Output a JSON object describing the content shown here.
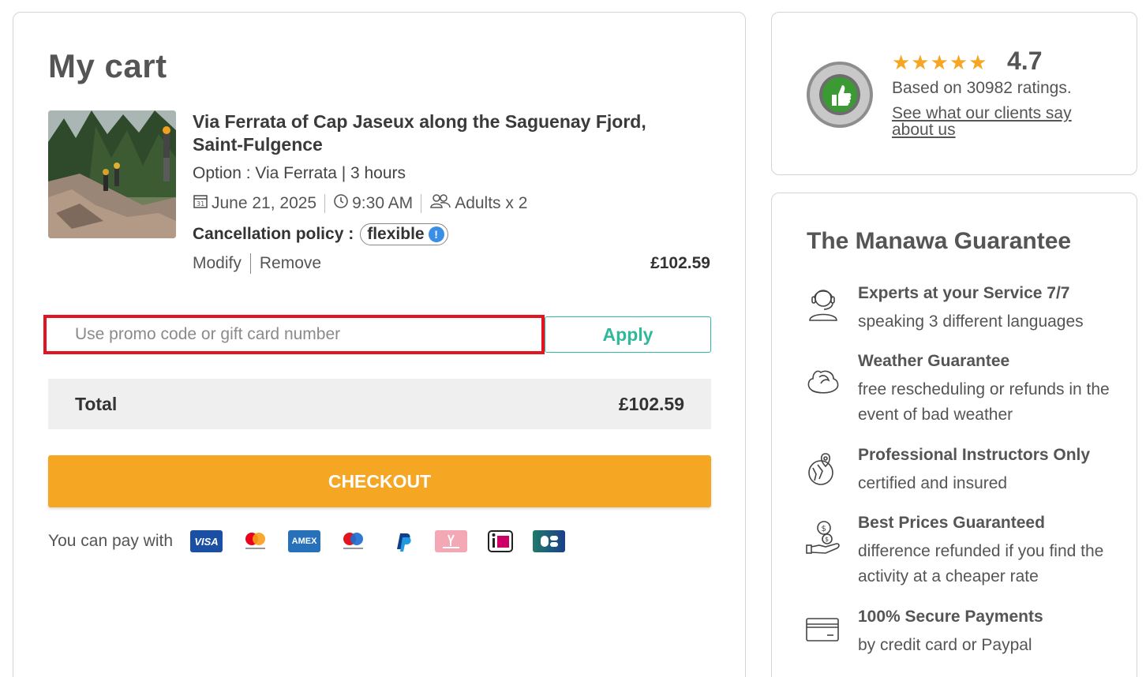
{
  "cart": {
    "title": "My cart",
    "item": {
      "title": "Via Ferrata of Cap Jaseux along the Saguenay Fjord, Saint-Fulgence",
      "option": "Option : Via Ferrata | 3 hours",
      "date": "June 21, 2025",
      "time": "9:30 AM",
      "participants": "Adults x 2",
      "cancellation_label": "Cancellation policy :",
      "cancellation_value": "flexible",
      "modify_label": "Modify",
      "remove_label": "Remove",
      "price": "£102.59"
    },
    "promo": {
      "placeholder": "Use promo code or gift card number",
      "apply_label": "Apply"
    },
    "total": {
      "label": "Total",
      "value": "£102.59"
    },
    "checkout_label": "CHECKOUT",
    "payment": {
      "label": "You can pay with",
      "methods": [
        "visa",
        "mastercard",
        "amex",
        "maestro",
        "paypal",
        "sofort",
        "ideal",
        "cb"
      ]
    }
  },
  "rating": {
    "stars": "★★★★★",
    "value": "4.7",
    "count": "Based on 30982 ratings.",
    "link": "See what our clients say about us"
  },
  "guarantee": {
    "title": "The Manawa Guarantee",
    "items": [
      {
        "icon": "headset-icon",
        "head": "Experts at your Service 7/7",
        "desc": "speaking 3 different languages"
      },
      {
        "icon": "weather-icon",
        "head": "Weather Guarantee",
        "desc": "free rescheduling or refunds in the event of bad weather"
      },
      {
        "icon": "instructor-icon",
        "head": "Professional Instructors Only",
        "desc": "certified and insured"
      },
      {
        "icon": "price-icon",
        "head": "Best Prices Guaranteed",
        "desc": "difference refunded if you find the activity at a cheaper rate"
      },
      {
        "icon": "card-icon",
        "head": "100% Secure Payments",
        "desc": "by credit card or Paypal"
      }
    ]
  },
  "colors": {
    "accent": "#f5a623",
    "apply": "#2fb89a",
    "highlight": "#e3141f"
  }
}
